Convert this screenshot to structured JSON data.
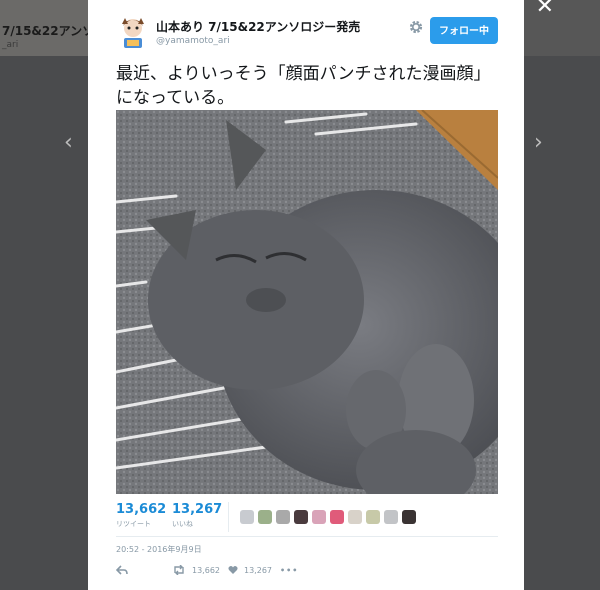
{
  "background": {
    "user_text": "7/15&22アンソ",
    "user_sub": "_ari"
  },
  "navigation": {
    "prev_icon": "‹",
    "next_icon": "›",
    "close_icon": "✕"
  },
  "tweet": {
    "display_name": "山本あり 7/15&22アンソロジー発売",
    "handle": "@yamamoto_ari",
    "follow_label": "フォロー中",
    "text": "最近、よりいっそう「顔面パンチされた漫画顔」になっている。",
    "retweets": "13,662",
    "retweets_label": "リツイート",
    "likes": "13,267",
    "likes_label": "いいね",
    "timestamp": "20:52 - 2016年9月9日",
    "action_retweets": "13,662",
    "action_likes": "13,267",
    "more_icon": "•••"
  },
  "colors": {
    "accent": "#2b9ceb",
    "link_blue": "#1b8bd6"
  }
}
